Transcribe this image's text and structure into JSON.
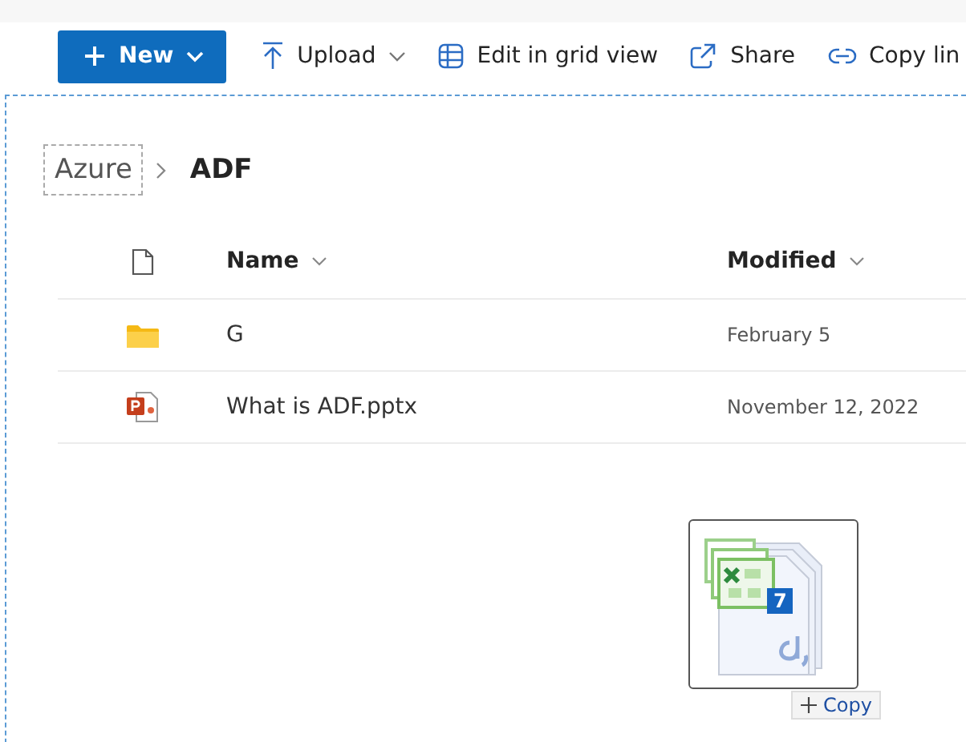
{
  "toolbar": {
    "new_button": {
      "label": "New"
    },
    "items": [
      {
        "kind": "upload",
        "label": "Upload",
        "has_caret": true
      },
      {
        "kind": "grid",
        "label": "Edit in grid view",
        "has_caret": false
      },
      {
        "kind": "share",
        "label": "Share",
        "has_caret": false
      },
      {
        "kind": "link",
        "label": "Copy lin",
        "has_caret": false
      }
    ]
  },
  "breadcrumb": [
    {
      "label": "Azure",
      "current": false
    },
    {
      "label": "ADF",
      "current": true
    }
  ],
  "table": {
    "columns": [
      {
        "label": "Name"
      },
      {
        "label": "Modified"
      }
    ],
    "rows": [
      {
        "kind": "folder",
        "name": "G",
        "modified": "February 5"
      },
      {
        "kind": "pptx",
        "name": "What is ADF.pptx",
        "modified": "November 12, 2022"
      }
    ]
  },
  "drag": {
    "count": "7",
    "action": "Copy"
  }
}
